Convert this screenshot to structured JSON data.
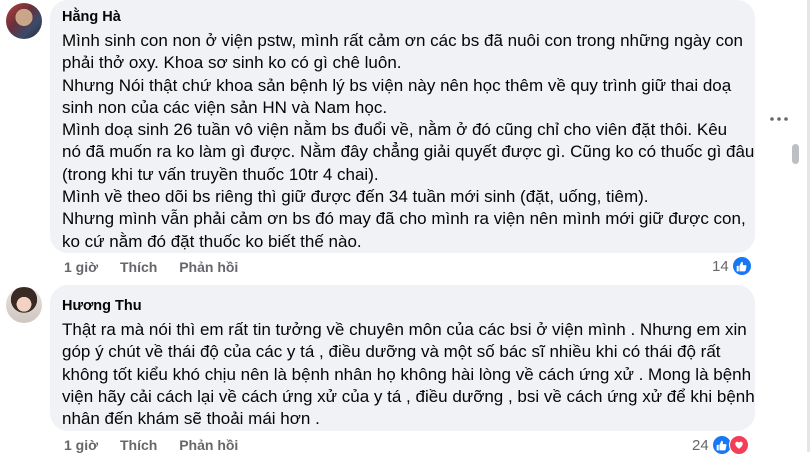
{
  "comments": [
    {
      "author": "Hằng Hà",
      "lines": [
        "Mình sinh con non ở viện pstw, mình rất cảm ơn các bs đã nuôi con trong những ngày con",
        "phải thở oxy. Khoa sơ sinh ko có gì chê luôn.",
        "Nhưng Nói thật chứ khoa sản bệnh lý bs viện này nên học thêm về quy trình giữ thai doạ",
        "sinh non của các viện sản HN và Nam học.",
        "Mình doạ sinh 26 tuần vô viện nằm bs đuổi về, nằm ở đó cũng chỉ cho viên đặt thôi. Kêu",
        "nó đã muốn ra ko làm gì được. Nằm đây chẳng giải quyết được gì. Cũng ko có thuốc gì đâu",
        "(trong khi tư vấn truyền thuốc 10tr 4 chai).",
        "Mình về theo dõi bs riêng thì giữ được đến 34 tuần mới sinh (đặt, uống, tiêm).",
        "Nhưng mình vẫn phải cảm ơn bs đó may đã cho mình ra viện nên mình mới giữ được con,",
        "ko cứ nằm đó đặt thuốc ko biết thế nào."
      ],
      "time": "1 giờ",
      "like_label": "Thích",
      "reply_label": "Phản hồi",
      "reaction_count": "14"
    },
    {
      "author": "Hương Thu",
      "lines": [
        "Thật ra mà nói thì em rất tin tưởng về chuyên môn của các bsi ở viện mình . Nhưng em xin",
        "góp ý chút về thái độ của các y tá , điều dưỡng và một số bác sĩ nhiều khi có thái độ rất",
        "không tốt kiểu khó chịu nên là bệnh nhân họ không hài lòng về cách ứng xử . Mong là bệnh",
        "viện hãy cải cách lại về cách ứng xử của y tá , điều dưỡng , bsi về cách ứng xử để khi bệnh",
        "nhân đến khám sẽ thoải mái hơn ."
      ],
      "time": "1 giờ",
      "like_label": "Thích",
      "reply_label": "Phản hồi",
      "reaction_count": "24"
    }
  ],
  "icons": {
    "like": "like-icon",
    "love": "love-icon",
    "more": "more-options-icon"
  },
  "colors": {
    "bubble": "#f0f2f5",
    "like_blue": "#1877f2",
    "love_red": "#f33e58",
    "meta_gray": "#65676b"
  }
}
